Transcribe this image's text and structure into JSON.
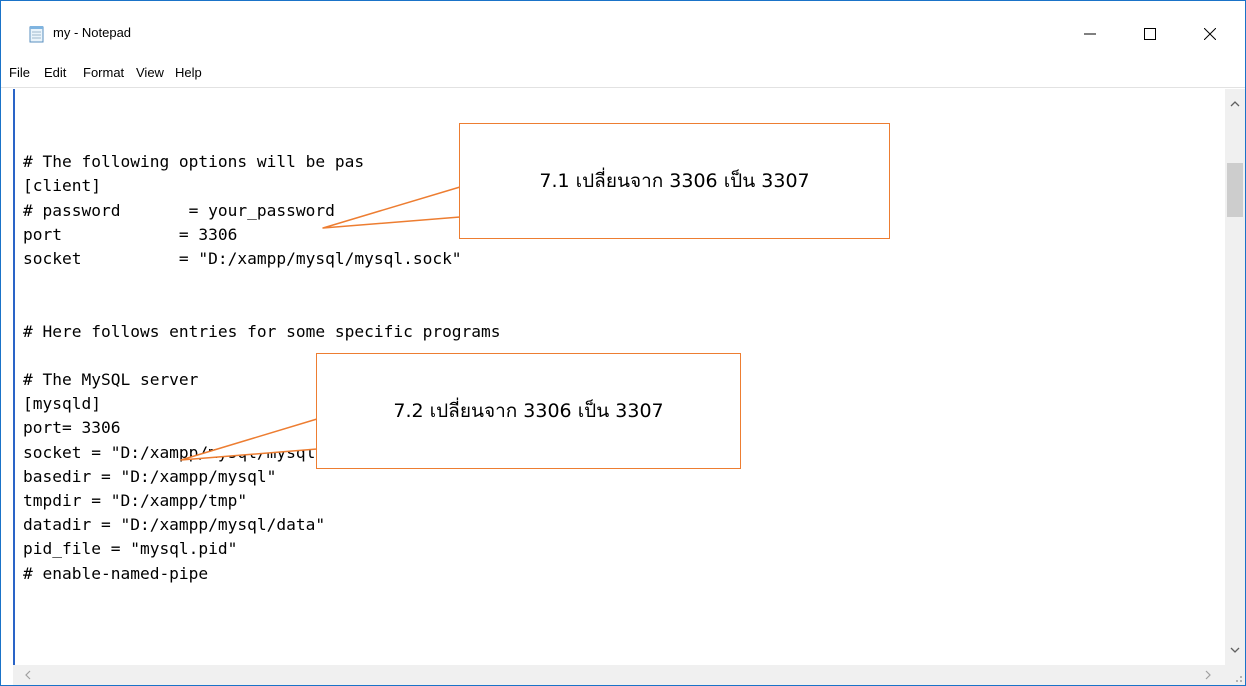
{
  "window": {
    "title": "my - Notepad"
  },
  "menu": [
    "File",
    "Edit",
    "Format",
    "View",
    "Help"
  ],
  "editor_lines": [
    "",
    "# The following options will be pas",
    "[client]",
    "# password       = your_password",
    "port            = 3306",
    "socket          = \"D:/xampp/mysql/mysql.sock\"",
    "",
    "",
    "# Here follows entries for some specific programs",
    "",
    "# The MySQL server",
    "[mysqld]",
    "port= 3306",
    "socket = \"D:/xampp/mysql/mysql.sock\"",
    "basedir = \"D:/xampp/mysql\"",
    "tmpdir = \"D:/xampp/tmp\"",
    "datadir = \"D:/xampp/mysql/data\"",
    "pid_file = \"mysql.pid\"",
    "# enable-named-pipe"
  ],
  "callouts": [
    {
      "label": "7.1 เปลี่ยนจาก 3306 เป็น 3307"
    },
    {
      "label": "7.2 เปลี่ยนจาก 3306 เป็น 3307"
    }
  ],
  "icons": {
    "app": "notepad-icon",
    "minimize": "minimize-icon",
    "maximize": "maximize-icon",
    "close": "close-icon",
    "scroll_up": "chevron-up-icon",
    "scroll_down": "chevron-down-icon",
    "scroll_left": "chevron-left-icon",
    "scroll_right": "chevron-right-icon"
  },
  "colors": {
    "window_border": "#1a73c8",
    "callout_border": "#ed7d31",
    "editor_left_border": "#2a64c7"
  }
}
